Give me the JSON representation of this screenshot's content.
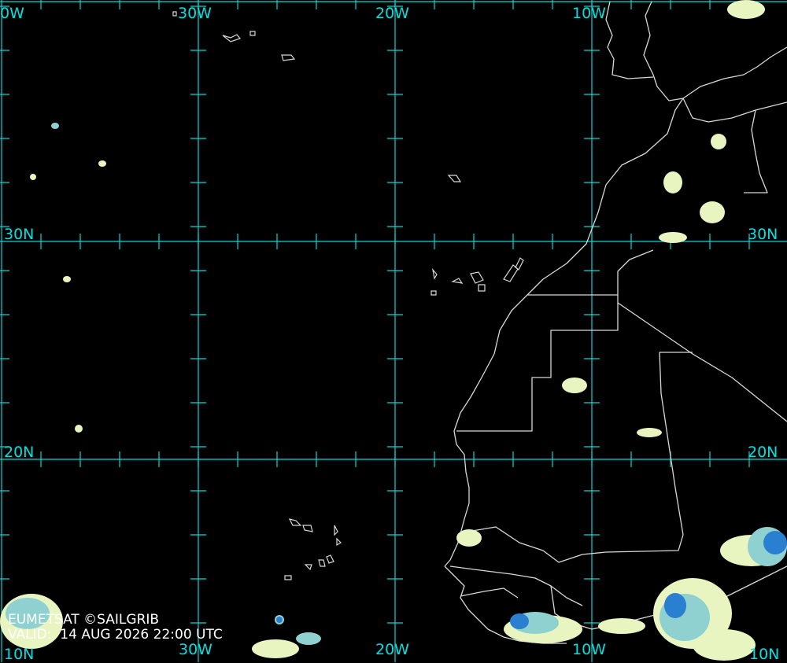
{
  "map": {
    "source": "EUMETSAT ©SAILGRIB",
    "valid_label": "VALID:",
    "valid_time": "14 AUG 2026 22:00 UTC",
    "lon_labels": {
      "w40_top": "0W",
      "w30_top": "30W",
      "w20_top": "20W",
      "w10_top": "10W",
      "w30_bottom": "30W",
      "w20_bottom": "20W",
      "w10_bottom": "10W"
    },
    "lat_labels": {
      "n30_left": "30N",
      "n20_left": "20N",
      "n10_left": "10N",
      "n30_right": "30N",
      "n20_right": "20N",
      "n10_right": "10N"
    },
    "colors": {
      "graticule": "#00d8d8",
      "coastline": "#d8d8d8",
      "cloud_light": "#e8f5c0",
      "cloud_mid": "#8fd0d0",
      "cloud_deep": "#2a7fd0"
    }
  }
}
